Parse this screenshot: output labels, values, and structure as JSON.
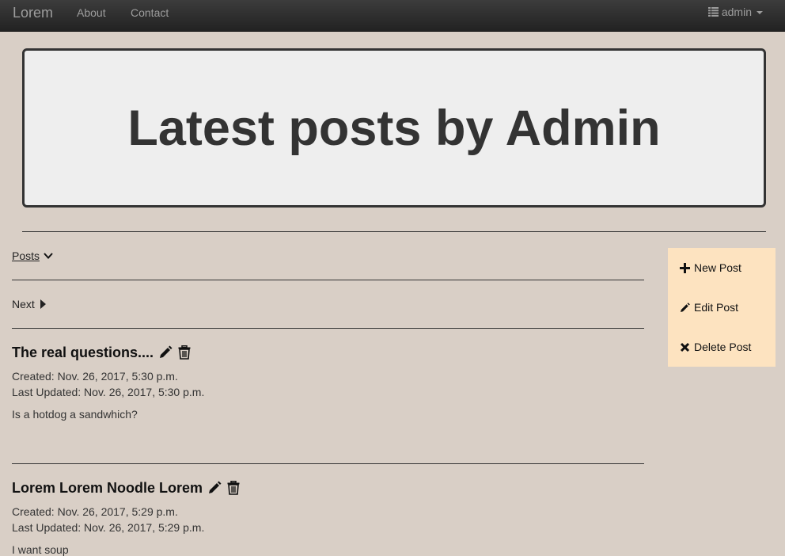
{
  "navbar": {
    "brand": "Lorem",
    "links": [
      "About",
      "Contact"
    ],
    "user": "admin"
  },
  "jumbotron": {
    "title": "Latest posts by Admin"
  },
  "posts_toggle": {
    "label": "Posts"
  },
  "pagination": {
    "next_label": "Next"
  },
  "posts": [
    {
      "title": "The real questions....",
      "created": "Created: Nov. 26, 2017, 5:30 p.m.",
      "updated": "Last Updated: Nov. 26, 2017, 5:30 p.m.",
      "body": "Is a hotdog a sandwhich?"
    },
    {
      "title": "Lorem Lorem Noodle Lorem",
      "created": "Created: Nov. 26, 2017, 5:29 p.m.",
      "updated": "Last Updated: Nov. 26, 2017, 5:29 p.m.",
      "body": "I want soup"
    }
  ],
  "sidebar": {
    "items": [
      {
        "label": "New Post",
        "icon": "plus-icon"
      },
      {
        "label": "Edit Post",
        "icon": "pencil-icon"
      },
      {
        "label": "Delete Post",
        "icon": "x-icon"
      }
    ]
  },
  "colors": {
    "background": "#d9cfc6",
    "navbar": "#222222",
    "jumbotron": "#eeeeee",
    "sidebar": "#fde3c0"
  }
}
